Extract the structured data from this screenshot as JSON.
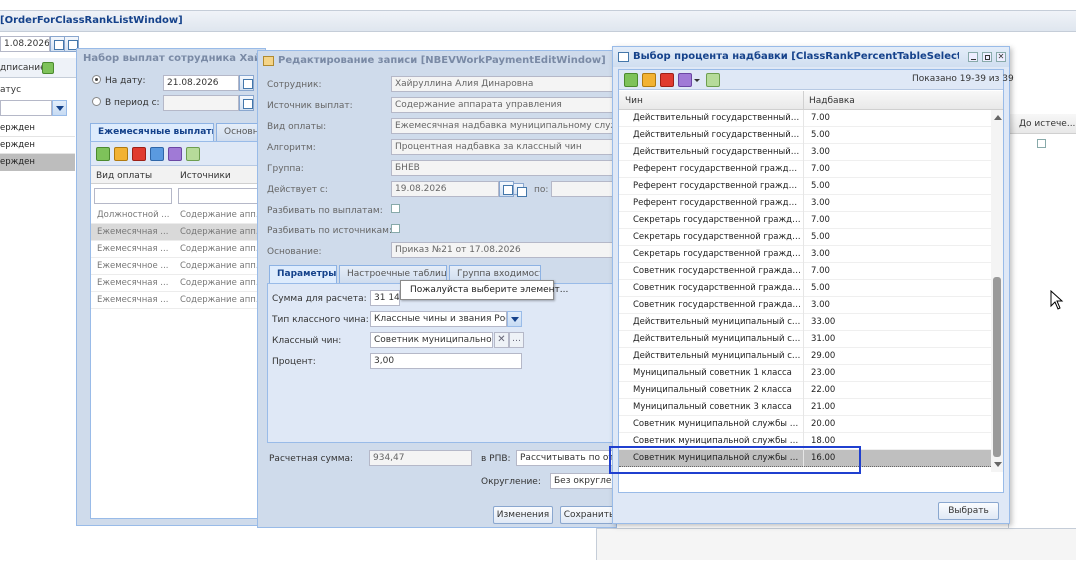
{
  "back_window": {
    "title": "[OrderForClassRankListWindow]",
    "date_value": "1.08.2026",
    "signing_label": "дписание",
    "status_label": "атус",
    "rows": [
      "ержден",
      "ержден",
      "ержден"
    ]
  },
  "right_panel": {
    "col_until_change": "До истече..."
  },
  "employee_window": {
    "title": "Набор выплат сотрудника Хайруллин...",
    "radio_date_label": "На дату:",
    "date_value": "21.08.2026",
    "radio_period_label": "В период с:",
    "tab_monthly": "Ежемесячные выплаты",
    "tab_main": "Основн...",
    "col_payment_type": "Вид оплаты",
    "col_sources": "Источники",
    "rows": [
      {
        "type": "Должностной ...",
        "source": "Содержание апп..."
      },
      {
        "type": "Ежемесячная ...",
        "source": "Содержание апп..."
      },
      {
        "type": "Ежемесячная ...",
        "source": "Содержание апп..."
      },
      {
        "type": "Ежемесячное ...",
        "source": "Содержание апп..."
      },
      {
        "type": "Ежемесячная ...",
        "source": "Содержание апп..."
      },
      {
        "type": "Ежемесячная ...",
        "source": "Содержание апп..."
      }
    ]
  },
  "edit_window": {
    "title": "Редактирование записи [NBEVWorkPaymentEditWindow]",
    "employee_label": "Сотрудник:",
    "employee_value": "Хайруллина Алия Динаровна",
    "source_label": "Источник выплат:",
    "source_value": "Содержание аппарата управления",
    "payment_type_label": "Вид оплаты:",
    "payment_type_value": "Ежемесячная надбавка муниципальному служащ...",
    "algorithm_label": "Алгоритм:",
    "algorithm_value": "Процентная надбавка за классный чин",
    "group_label": "Группа:",
    "group_value": "БНЕВ",
    "valid_from_label": "Действует с:",
    "valid_from_value": "19.08.2026",
    "to_label": "по:",
    "split_payments_label": "Разбивать по выплатам:",
    "split_sources_label": "Разбивать по источникам:",
    "basis_label": "Основание:",
    "basis_value": "Приказ №21 от 17.08.2026",
    "tab_params": "Параметры",
    "tab_settings": "Настроечные таблицы",
    "tab_group": "Группа входимости",
    "calc_sum_label": "Сумма для расчета:",
    "calc_sum_value": "31 14...",
    "rank_type_label": "Тип классного чина:",
    "rank_type_value": "Классные чины и звания Росс...",
    "rank_label": "Классный чин:",
    "rank_value": "Советник муниципальной ...",
    "percent_label": "Процент:",
    "percent_value": "3,00",
    "tooltip": "Пожалуйста выберите элемент...",
    "result_label": "Расчетная сумма:",
    "result_value": "934,47",
    "rpv_label": "в РПВ:",
    "rpv_value": "Рассчитывать по отр...",
    "rounding_label": "Округление:",
    "rounding_value": "Без округлен...",
    "btn_changes": "Изменения",
    "btn_save": "Сохранить"
  },
  "select_window": {
    "title": "Выбор процента надбавки [ClassRankPercentTableSelectWindow]",
    "shown": "Показано 19-39 из 39",
    "col_rank": "Чин",
    "col_bonus": "Надбавка",
    "select_button": "Выбрать",
    "rows": [
      {
        "rank": "Действительный государственный сов...",
        "bonus": "7.00"
      },
      {
        "rank": "Действительный государственный сов...",
        "bonus": "5.00"
      },
      {
        "rank": "Действительный государственный сов...",
        "bonus": "3.00"
      },
      {
        "rank": "Референт государственной гражданск...",
        "bonus": "7.00"
      },
      {
        "rank": "Референт государственной гражданск...",
        "bonus": "5.00"
      },
      {
        "rank": "Референт государственной гражданск...",
        "bonus": "3.00"
      },
      {
        "rank": "Секретарь государственной гражданск...",
        "bonus": "7.00"
      },
      {
        "rank": "Секретарь государственной гражданск...",
        "bonus": "5.00"
      },
      {
        "rank": "Секретарь государственной гражданск...",
        "bonus": "3.00"
      },
      {
        "rank": "Советник государственной гражданско...",
        "bonus": "7.00"
      },
      {
        "rank": "Советник государственной гражданско...",
        "bonus": "5.00"
      },
      {
        "rank": "Советник государственной гражданско...",
        "bonus": "3.00"
      },
      {
        "rank": "Действительный муниципальный совет...",
        "bonus": "33.00"
      },
      {
        "rank": "Действительный муниципальный совет...",
        "bonus": "31.00"
      },
      {
        "rank": "Действительный муниципальный совет...",
        "bonus": "29.00"
      },
      {
        "rank": "Муниципальный советник 1 класса",
        "bonus": "23.00"
      },
      {
        "rank": "Муниципальный советник 2 класса",
        "bonus": "22.00"
      },
      {
        "rank": "Муниципальный советник 3 класса",
        "bonus": "21.00"
      },
      {
        "rank": "Советник муниципальной службы 1 кл...",
        "bonus": "20.00"
      },
      {
        "rank": "Советник муниципальной службы 2 кл...",
        "bonus": "18.00"
      },
      {
        "rank": "Советник муниципальной службы 3 кл...",
        "bonus": "16.00"
      }
    ],
    "selected_index": 20
  },
  "colors": {
    "highlight": "#1f3fcf",
    "window_header": "#dfe8f6",
    "selected_row": "#bfbfbf"
  }
}
